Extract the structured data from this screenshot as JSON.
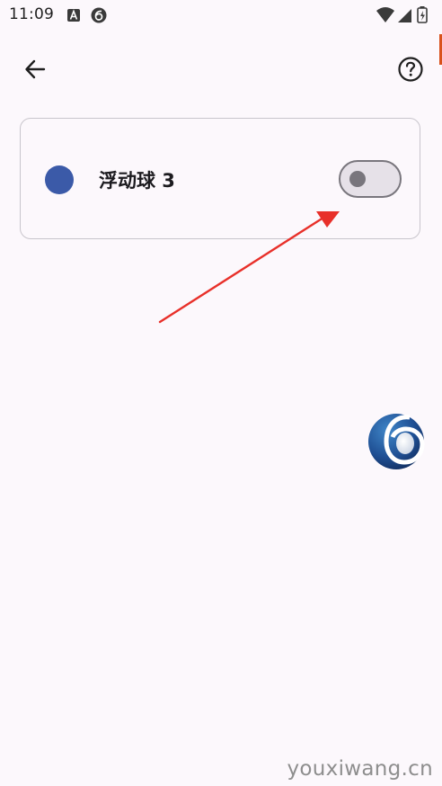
{
  "status_bar": {
    "time": "11:09",
    "left_icons": [
      "keyboard-a-icon",
      "app-badge-6-icon"
    ],
    "right_icons": [
      "wifi-icon",
      "cellular-signal-icon",
      "battery-charging-icon"
    ]
  },
  "app_bar": {
    "back_icon": "arrow-back-icon",
    "help_icon": "help-circle-icon"
  },
  "card": {
    "title": "浮动球 3",
    "dot_color": "#3b5aa8",
    "toggle_state": "off"
  },
  "annotation": {
    "arrow_color": "#e8302a"
  },
  "floating_ball": {
    "icon": "floating-ball-6-icon"
  },
  "watermark": {
    "text": "youxiwang.cn"
  },
  "colors": {
    "background": "#fcf8fc",
    "card_border": "#c8c5cc",
    "toggle_track": "#e6e1e8",
    "toggle_outline": "#79767d",
    "edge_accent": "#d9511b"
  }
}
